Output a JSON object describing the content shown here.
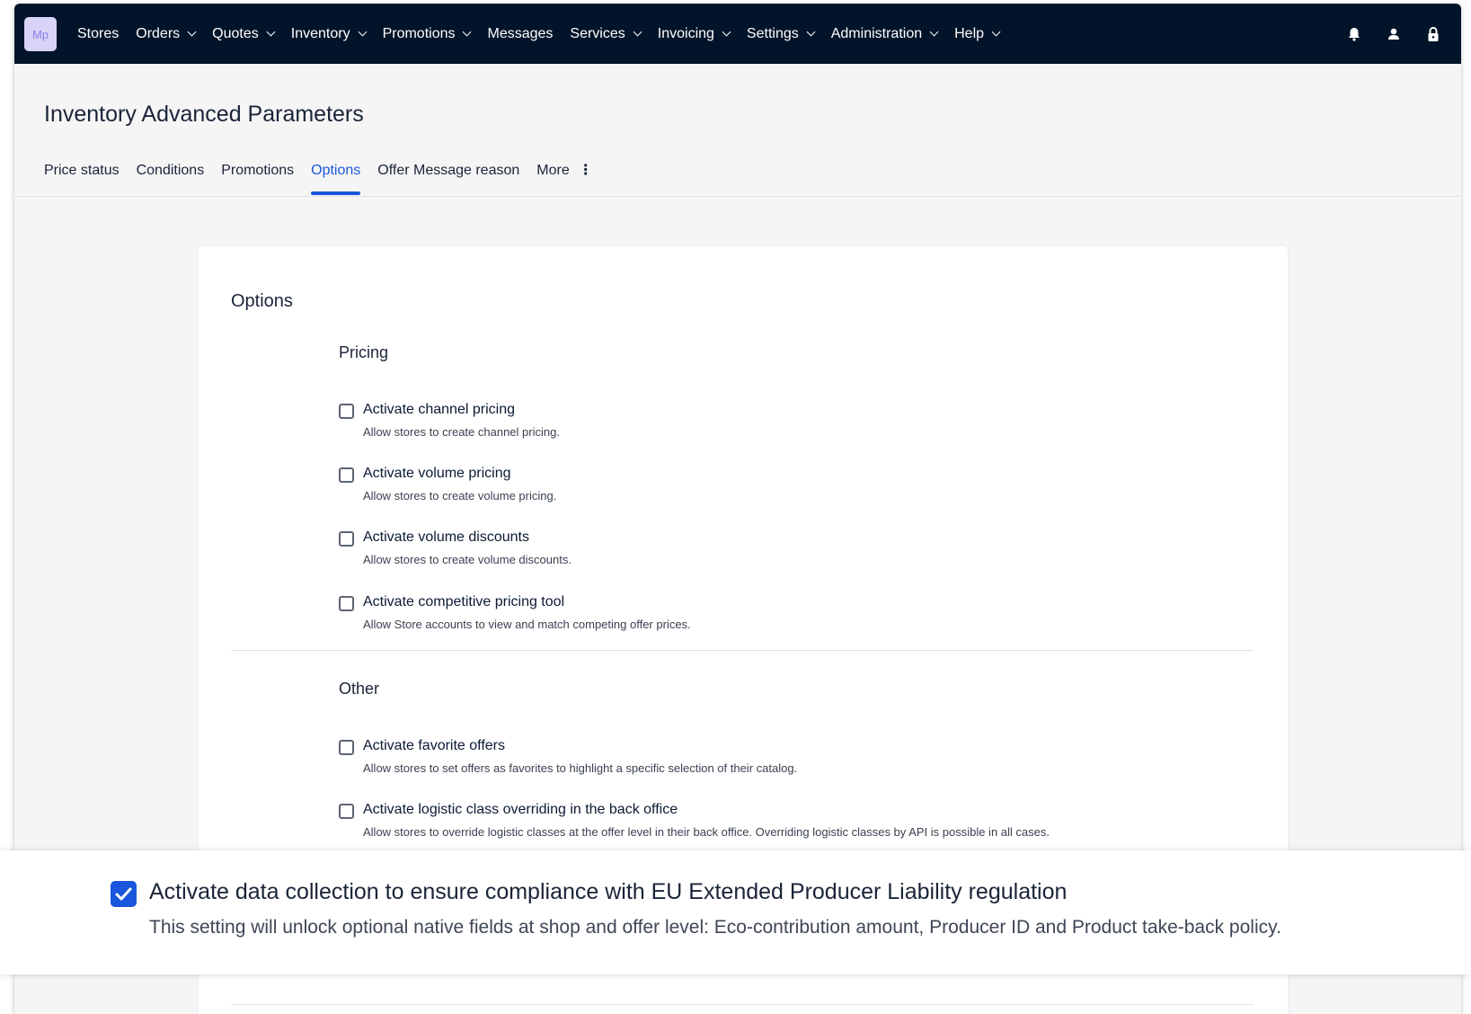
{
  "app": {
    "logo_text": "Mp"
  },
  "nav": {
    "items": [
      {
        "label": "Stores",
        "dropdown": false
      },
      {
        "label": "Orders",
        "dropdown": true
      },
      {
        "label": "Quotes",
        "dropdown": true
      },
      {
        "label": "Inventory",
        "dropdown": true
      },
      {
        "label": "Promotions",
        "dropdown": true
      },
      {
        "label": "Messages",
        "dropdown": false
      },
      {
        "label": "Services",
        "dropdown": true
      },
      {
        "label": "Invoicing",
        "dropdown": true
      },
      {
        "label": "Settings",
        "dropdown": true
      },
      {
        "label": "Administration",
        "dropdown": true
      },
      {
        "label": "Help",
        "dropdown": true
      }
    ],
    "icons": [
      "bell-icon",
      "user-icon",
      "lock-icon"
    ]
  },
  "page": {
    "title": "Inventory Advanced Parameters"
  },
  "tabs": [
    {
      "label": "Price status",
      "active": false
    },
    {
      "label": "Conditions",
      "active": false
    },
    {
      "label": "Promotions",
      "active": false
    },
    {
      "label": "Options",
      "active": true
    },
    {
      "label": "Offer Message reason",
      "active": false
    },
    {
      "label": "More",
      "active": false,
      "icon": "more-vertical-icon"
    }
  ],
  "card": {
    "title": "Options",
    "sections": [
      {
        "title": "Pricing",
        "options": [
          {
            "label": "Activate channel pricing",
            "description": "Allow stores to create channel pricing.",
            "checked": false
          },
          {
            "label": "Activate volume pricing",
            "description": "Allow stores to create volume pricing.",
            "checked": false
          },
          {
            "label": "Activate volume discounts",
            "description": "Allow stores to create volume discounts.",
            "checked": false
          },
          {
            "label": "Activate competitive pricing tool",
            "description": "Allow Store accounts to view and match competing offer prices.",
            "checked": false
          }
        ]
      },
      {
        "title": "Other",
        "options": [
          {
            "label": "Activate favorite offers",
            "description": "Allow stores to set offers as favorites to highlight a specific selection of their catalog.",
            "checked": false
          },
          {
            "label": "Activate logistic class overriding in the back office",
            "description": "Allow stores to override logistic classes at the offer level in their back office. Overriding logistic classes by API is possible in all cases.",
            "checked": false
          }
        ]
      }
    ]
  },
  "highlight": {
    "label": "Activate data collection to ensure compliance with EU Extended Producer Liability regulation",
    "description": "This setting will unlock optional native fields at shop and offer level: Eco-contribution amount, Producer ID and Product take-back policy.",
    "checked": true
  },
  "colors": {
    "topbar": "#021429",
    "accent": "#1a56db",
    "logo_bg": "#d9d3f7"
  }
}
